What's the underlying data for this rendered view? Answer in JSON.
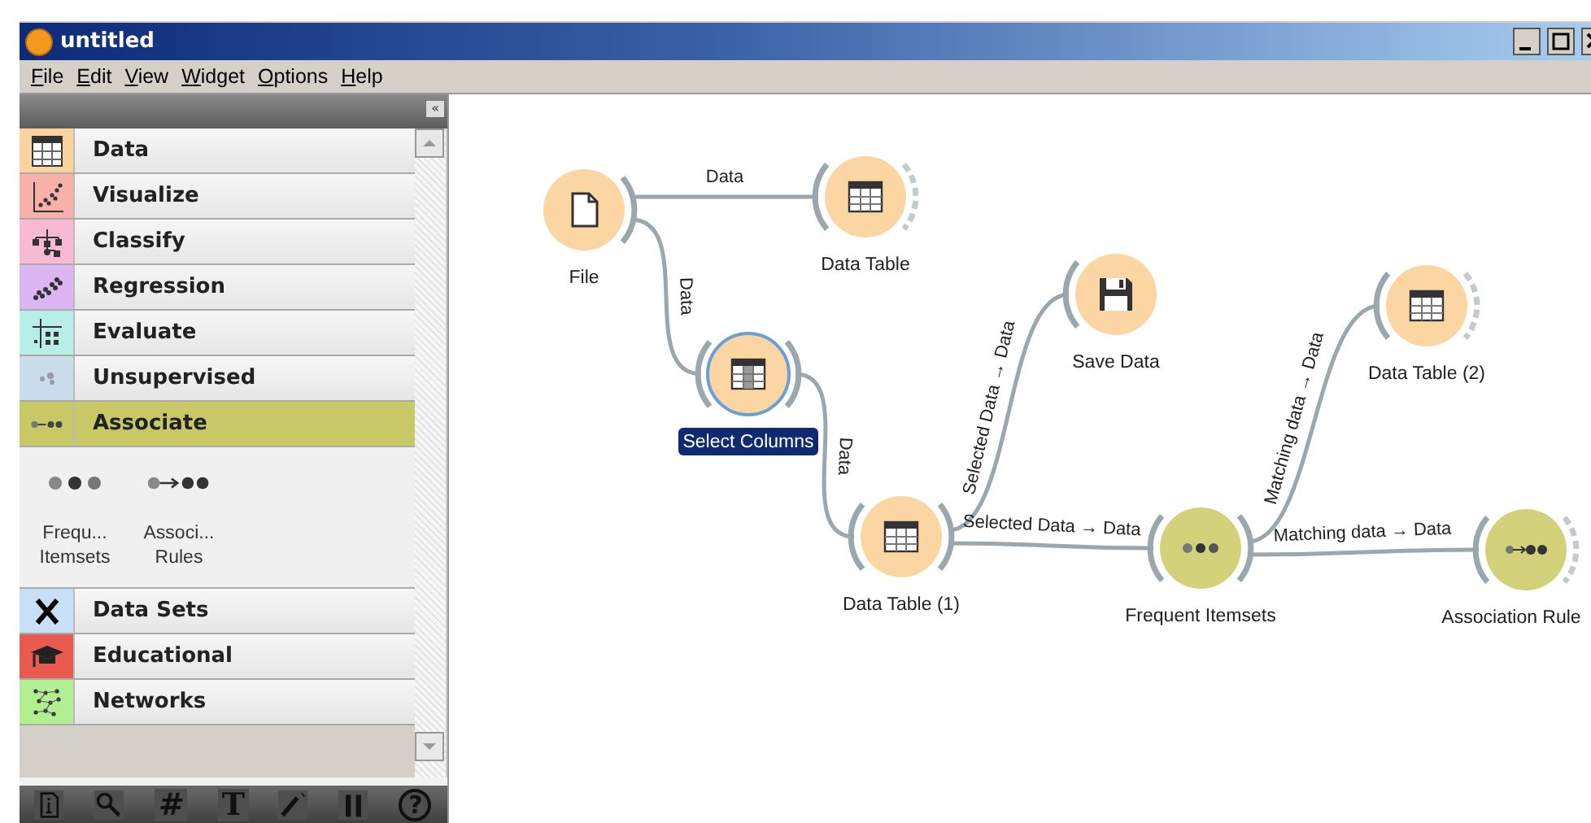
{
  "window": {
    "title": "untitled"
  },
  "menu": [
    "File",
    "Edit",
    "View",
    "Widget",
    "Options",
    "Help"
  ],
  "sidebar": {
    "collapse": "«",
    "categories": [
      {
        "label": "Data",
        "color": "#fbd39e",
        "selected": false
      },
      {
        "label": "Visualize",
        "color": "#f7b0aa",
        "selected": false
      },
      {
        "label": "Classify",
        "color": "#f8b9d2",
        "selected": false
      },
      {
        "label": "Regression",
        "color": "#dcb6f3",
        "selected": false
      },
      {
        "label": "Evaluate",
        "color": "#b7eee8",
        "selected": false
      },
      {
        "label": "Unsupervised",
        "color": "#c9dcea",
        "selected": false
      },
      {
        "label": "Associate",
        "color": "#c9c866",
        "selected": true,
        "widgets": [
          {
            "label": "Frequ...\nItemsets",
            "kind": "itemsets"
          },
          {
            "label": "Associ...\nRules",
            "kind": "rules"
          }
        ]
      },
      {
        "label": "Data Sets",
        "color": "#c8e0f6",
        "selected": false
      },
      {
        "label": "Educational",
        "color": "#e85a50",
        "selected": false
      },
      {
        "label": "Networks",
        "color": "#b2ef92",
        "selected": false
      }
    ]
  },
  "toolbar": {
    "grid": "#",
    "text": "T",
    "help": "?"
  },
  "canvas": {
    "nodes": [
      {
        "label": "File",
        "kind": "file",
        "color": "#fbd5a2",
        "selected": false,
        "has_input": false,
        "has_output": true,
        "output_connected": true
      },
      {
        "label": "Data Table",
        "kind": "table",
        "color": "#fbd5a2",
        "selected": false,
        "has_input": true,
        "has_output": true,
        "output_connected": false
      },
      {
        "label": "Select Columns",
        "kind": "select",
        "color": "#fbd5a2",
        "selected": true,
        "has_input": true,
        "has_output": true,
        "output_connected": true
      },
      {
        "label": "Data Table (1)",
        "kind": "table",
        "color": "#fbd5a2",
        "selected": false,
        "has_input": true,
        "has_output": true,
        "output_connected": true
      },
      {
        "label": "Save Data",
        "kind": "save",
        "color": "#fbd5a2",
        "selected": false,
        "has_input": true,
        "has_output": false
      },
      {
        "label": "Data Table (2)",
        "kind": "table",
        "color": "#fbd5a2",
        "selected": false,
        "has_input": true,
        "has_output": true,
        "output_connected": false
      },
      {
        "label": "Frequent Itemsets",
        "kind": "itemsets",
        "color": "#d3d27a",
        "selected": false,
        "has_input": true,
        "has_output": true,
        "output_connected": true
      },
      {
        "label": "Association Rule",
        "kind": "rules",
        "color": "#d3d27a",
        "selected": false,
        "has_input": true,
        "has_output": true,
        "output_connected": false
      }
    ],
    "links": [
      {
        "label": "Data"
      },
      {
        "label": "Data"
      },
      {
        "label": "Data"
      },
      {
        "label": "Selected Data → Data"
      },
      {
        "label": "Selected Data → Data"
      },
      {
        "label": "Matching data → Data"
      },
      {
        "label": "Matching data → Data"
      }
    ]
  }
}
